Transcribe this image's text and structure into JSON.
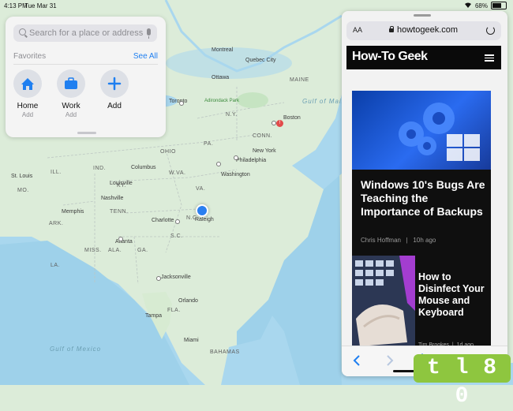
{
  "status_bar": {
    "time": "4:13 PM",
    "date": "Tue Mar 31",
    "battery": "68%"
  },
  "map": {
    "states": [
      "MAINE",
      "N.Y.",
      "PA.",
      "OHIO",
      "W.VA.",
      "VA.",
      "N.C.",
      "S.C.",
      "TENN.",
      "KY.",
      "ILL.",
      "IND.",
      "MO.",
      "ARK.",
      "MISS.",
      "ALA.",
      "GA.",
      "LA.",
      "FLA.",
      "CONN."
    ],
    "cities": [
      "Montreal",
      "Quebec City",
      "Ottawa",
      "Toronto",
      "Boston",
      "New York",
      "Philadelphia",
      "Washington",
      "Charlotte",
      "Atlanta",
      "Nashville",
      "Memphis",
      "Jacksonville",
      "Orlando",
      "Tampa",
      "Miami",
      "Raleigh",
      "Columbus",
      "Louisville",
      "St. Louis"
    ],
    "water": [
      "Gulf of Maine",
      "Gulf of Mexico"
    ],
    "other": [
      "Adirondack Park",
      "BAHAMAS"
    ]
  },
  "panel": {
    "search_placeholder": "Search for a place or address",
    "favorites_title": "Favorites",
    "see_all": "See All",
    "favorites": [
      {
        "label": "Home",
        "sub": "Add",
        "icon": "house-icon"
      },
      {
        "label": "Work",
        "sub": "Add",
        "icon": "briefcase-icon"
      },
      {
        "label": "Add",
        "sub": "",
        "icon": "plus-icon"
      }
    ]
  },
  "safari": {
    "aa": "AA",
    "domain": "howtogeek.com",
    "site_logo": "How-To Geek",
    "article1": {
      "title": "Windows 10's Bugs Are Teaching the Importance of Backups",
      "author": "Chris Hoffman",
      "time": "10h ago"
    },
    "article2": {
      "title": "How to Disinfect Your Mouse and Keyboard",
      "author": "Tim Brookes",
      "time": "1d ago"
    }
  },
  "watermark": "t l 8 0",
  "colors": {
    "accent": "#1f7ff0",
    "location": "#2a7ff0",
    "watermark": "#8ec63f"
  }
}
